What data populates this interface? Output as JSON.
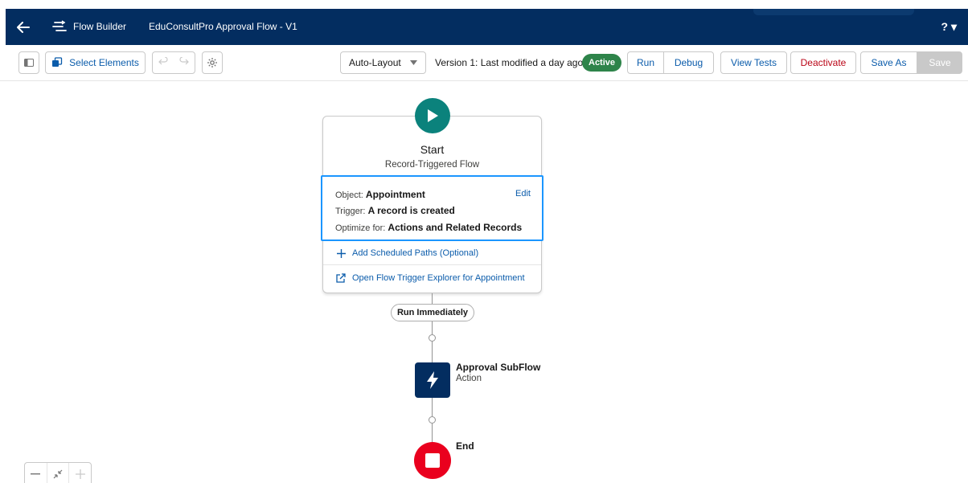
{
  "header": {
    "app_name": "Flow Builder",
    "flow_title": "EduConsultPro Approval Flow - V1",
    "help_label": "? ▾"
  },
  "toolbar": {
    "select_elements_label": "Select Elements",
    "layout_select_label": "Auto-Layout",
    "version_status": "Version 1: Last modified a day ago",
    "active_badge": "Active",
    "run_label": "Run",
    "debug_label": "Debug",
    "view_tests_label": "View Tests",
    "deactivate_label": "Deactivate",
    "save_as_label": "Save As",
    "save_label": "Save"
  },
  "start": {
    "title": "Start",
    "subtitle": "Record-Triggered Flow",
    "object_label": "Object:",
    "object_value": "Appointment",
    "trigger_label": "Trigger:",
    "trigger_value": "A record is created",
    "optimize_label": "Optimize for:",
    "optimize_value": "Actions and Related Records",
    "edit_label": "Edit",
    "add_paths_label": "Add Scheduled Paths (Optional)",
    "explorer_label": "Open Flow Trigger Explorer for Appointment"
  },
  "path_label": "Run Immediately",
  "action": {
    "title": "Approval SubFlow",
    "subtitle": "Action"
  },
  "end": {
    "label": "End"
  },
  "colors": {
    "header_bg": "#032d60",
    "start_green": "#0b827c",
    "active_green": "#2e844a",
    "end_red": "#ea001e",
    "link_blue": "#0b5cab",
    "selection_blue": "#1b96ff"
  }
}
